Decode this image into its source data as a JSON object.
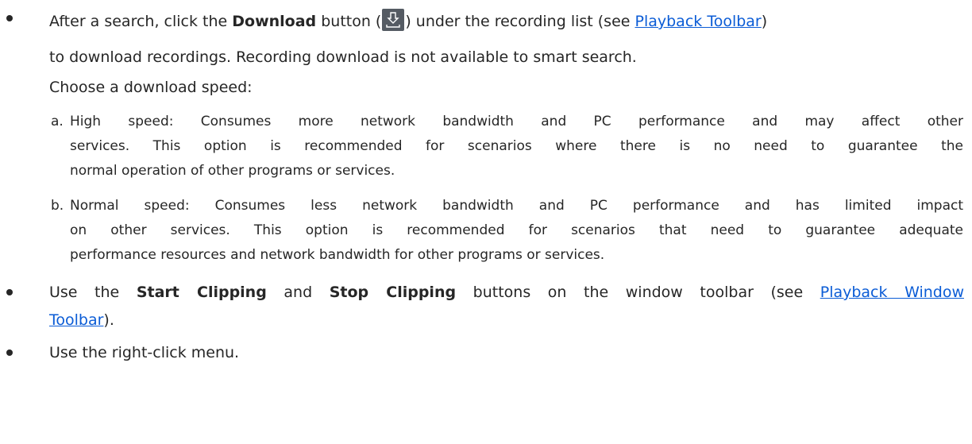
{
  "bullets": {
    "download": {
      "l1_a": "After a search, click the ",
      "l1_b": "Download",
      "l1_c": " button (",
      "l1_d": ") under the recording list (see ",
      "l1_link": "Playback Toolbar",
      "l1_e": ")",
      "l2": "to download recordings. Recording download is not available to smart search.",
      "l3": "Choose a download speed:",
      "icon": "download-icon",
      "options": [
        {
          "marker": "a.",
          "lines": [
            "High speed: Consumes more network bandwidth and PC performance and may affect other",
            "services. This option is recommended for scenarios where there is no need to guarantee the",
            "normal operation of other programs or services."
          ]
        },
        {
          "marker": "b.",
          "lines": [
            "Normal speed: Consumes less network bandwidth and PC performance and has limited impact",
            "on other services. This option is recommended for scenarios that need to guarantee adequate",
            "performance resources and network bandwidth for other programs or services."
          ]
        }
      ]
    },
    "clipping": {
      "a": "Use the ",
      "b": "Start Clipping",
      "c": " and ",
      "d": "Stop Clipping",
      "e": " buttons on the window toolbar (see ",
      "link1": "Playback Window",
      "link2": "Toolbar",
      "f": ")."
    },
    "menu": {
      "text": "Use the right-click menu."
    }
  },
  "colors": {
    "text": "#262626",
    "link": "#0b5cd6",
    "icon_bg": "#555b63"
  }
}
